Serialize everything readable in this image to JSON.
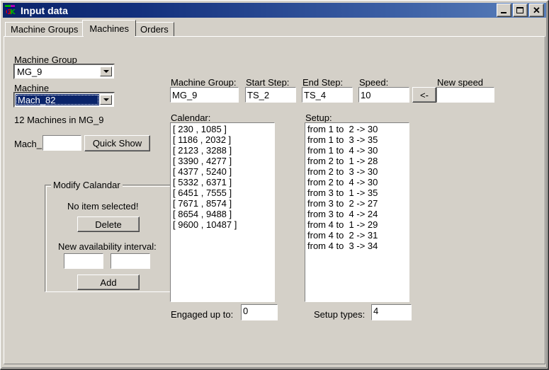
{
  "window": {
    "title": "Input data",
    "icon": "app-icon",
    "buttons": {
      "minimize": "_",
      "maximize": "□",
      "close": "✕"
    }
  },
  "tabs": [
    {
      "label": "Machine Groups",
      "selected": false
    },
    {
      "label": "Machines",
      "selected": true
    },
    {
      "label": "Orders",
      "selected": false
    }
  ],
  "left_panel": {
    "machine_group_label": "Machine Group",
    "machine_group_value": "MG_9",
    "machine_label": "Machine",
    "machine_value": "Mach_82",
    "count_text": "12 Machines in MG_9",
    "mach_prefix_label": "Mach_",
    "mach_quick_value": "",
    "quick_show_label": "Quick Show"
  },
  "modify_calendar": {
    "group_title": "Modify Calandar",
    "status_text": "No item selected!",
    "delete_label": "Delete",
    "new_interval_label": "New availability interval:",
    "interval_start_value": "",
    "interval_end_value": "",
    "add_label": "Add"
  },
  "detail_fields": {
    "machine_group_label": "Machine Group:",
    "machine_group_value": "MG_9",
    "start_step_label": "Start Step:",
    "start_step_value": "TS_2",
    "end_step_label": "End Step:",
    "end_step_value": "TS_4",
    "speed_label": "Speed:",
    "speed_value": "10",
    "apply_speed_label": "<-",
    "new_speed_label": "New speed",
    "new_speed_value": ""
  },
  "calendar": {
    "label": "Calendar:",
    "items": [
      "[ 230 , 1085 ]",
      "[ 1186 , 2032 ]",
      "[ 2123 , 3288 ]",
      "[ 3390 , 4277 ]",
      "[ 4377 , 5240 ]",
      "[ 5332 , 6371 ]",
      "[ 6451 , 7555 ]",
      "[ 7671 , 8574 ]",
      "[ 8654 , 9488 ]",
      "[ 9600 , 10487 ]"
    ]
  },
  "setup": {
    "label": "Setup:",
    "items": [
      "from 1 to  2 -> 30",
      "from 1 to  3 -> 35",
      "from 1 to  4 -> 30",
      "from 2 to  1 -> 28",
      "from 2 to  3 -> 30",
      "from 2 to  4 -> 30",
      "from 3 to  1 -> 35",
      "from 3 to  2 -> 27",
      "from 3 to  4 -> 24",
      "from 4 to  1 -> 29",
      "from 4 to  2 -> 31",
      "from 4 to  3 -> 34"
    ]
  },
  "footer": {
    "engaged_label": "Engaged up to:",
    "engaged_value": "0",
    "setup_types_label": "Setup types:",
    "setup_types_value": "4"
  },
  "colors": {
    "face": "#d4d0c8",
    "title_active_left": "#0a246a",
    "title_active_right": "#5a80bb",
    "highlight": "#0a246a",
    "text": "#000000"
  }
}
